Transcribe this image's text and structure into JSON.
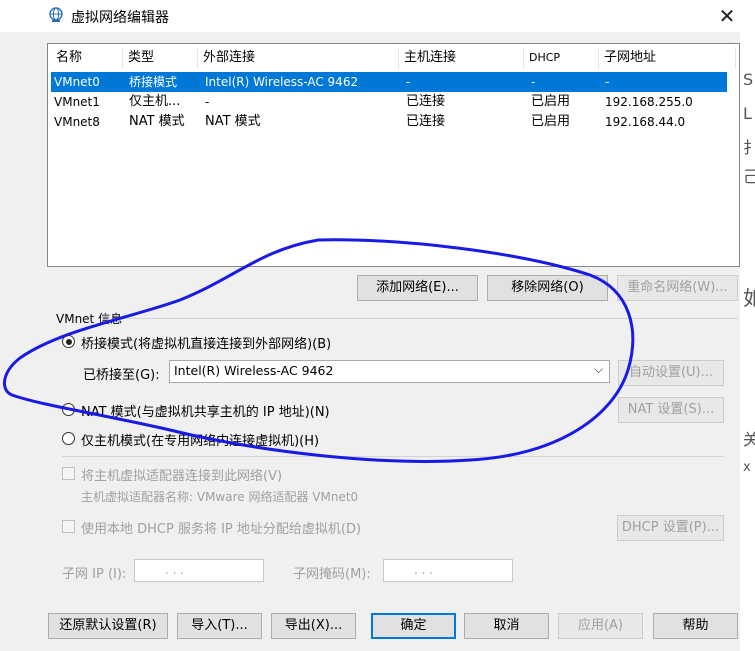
{
  "window": {
    "title": "虚拟网络编辑器",
    "close_label": "✕"
  },
  "table": {
    "headers": [
      "名称",
      "类型",
      "外部连接",
      "主机连接",
      "DHCP",
      "子网地址"
    ],
    "rows": [
      [
        "VMnet0",
        "桥接模式",
        "Intel(R) Wireless-AC 9462",
        "-",
        "-",
        "-"
      ],
      [
        "VMnet1",
        "仅主机...",
        "-",
        "已连接",
        "已启用",
        "192.168.255.0"
      ],
      [
        "VMnet8",
        "NAT 模式",
        "NAT 模式",
        "已连接",
        "已启用",
        "192.168.44.0"
      ]
    ],
    "selected_row": 0
  },
  "list_buttons": {
    "add": "添加网络(E)...",
    "remove": "移除网络(O)",
    "rename": "重命名网络(W)..."
  },
  "vmnet_info": {
    "group_label": "VMnet 信息",
    "bridge_radio": "桥接模式(将虚拟机直接连接到外部网络)(B)",
    "bridged_to_label": "已桥接至(G):",
    "bridged_to_value": "Intel(R) Wireless-AC 9462",
    "auto_settings": "自动设置(U)...",
    "nat_radio": "NAT 模式(与虚拟机共享主机的 IP 地址)(N)",
    "nat_settings": "NAT 设置(S)...",
    "hostonly_radio": "仅主机模式(在专用网络内连接虚拟机)(H)",
    "connect_adapter": "将主机虚拟适配器连接到此网络(V)",
    "adapter_name": "主机虚拟适配器名称: VMware 网络适配器 VMnet0",
    "use_dhcp": "使用本地 DHCP 服务将 IP 地址分配给虚拟机(D)",
    "dhcp_settings": "DHCP 设置(P)...",
    "subnet_ip_label": "子网 IP (I):",
    "subnet_ip_value": ".     .     .",
    "subnet_mask_label": "子网掩码(M):",
    "subnet_mask_value": ".     .     ."
  },
  "footer": {
    "restore": "还原默认设置(R)",
    "import": "导入(T)...",
    "export": "导出(X)...",
    "ok": "确定",
    "cancel": "取消",
    "apply": "应用(A)",
    "help": "帮助"
  },
  "background_text": [
    "S",
    "L",
    "扌",
    "己",
    "如",
    "关",
    "x"
  ],
  "colors": {
    "selection": "#0078d7",
    "annotation_ink": "#1a1ae6",
    "dialog_bg": "#f0f0f0"
  }
}
